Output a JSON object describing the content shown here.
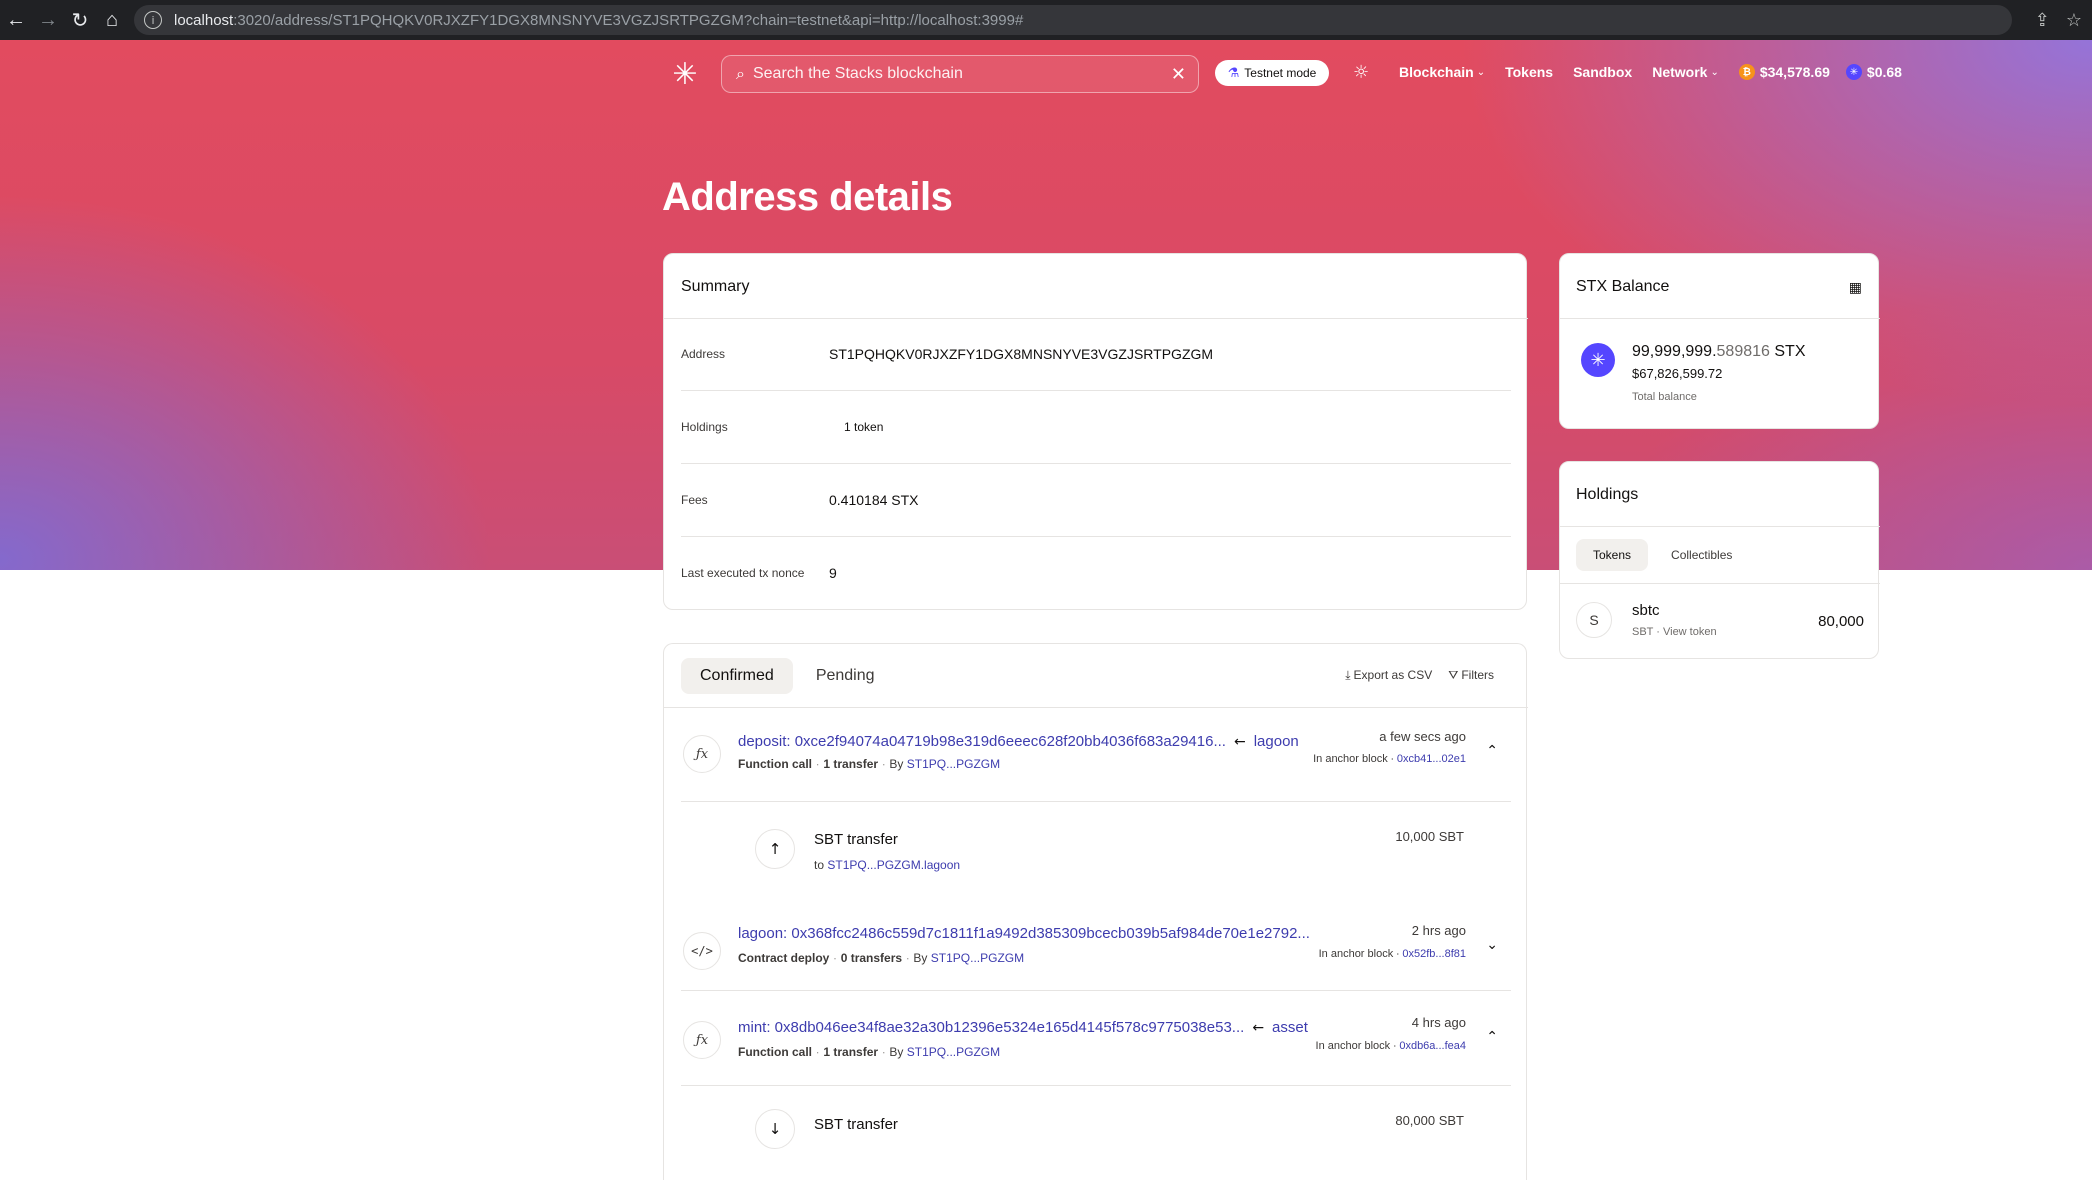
{
  "browser": {
    "url_host": "localhost",
    "url_path": ":3020/address/ST1PQHQKV0RJXZFY1DGX8MNSNYVE3VGZJSRTPGZGM?chain=testnet&api=http://localhost:3999#"
  },
  "nav": {
    "search_placeholder": "Search the Stacks blockchain",
    "testnet_label": "Testnet mode",
    "links": [
      "Blockchain",
      "Tokens",
      "Sandbox",
      "Network"
    ],
    "btc_price": "$34,578.69",
    "stx_price": "$0.68"
  },
  "page": {
    "title": "Address details"
  },
  "summary": {
    "header": "Summary",
    "rows": [
      {
        "label": "Address",
        "value": "ST1PQHQKV0RJXZFY1DGX8MNSNYVE3VGZJSRTPGZGM"
      },
      {
        "label": "Holdings",
        "value": "1 token"
      },
      {
        "label": "Fees",
        "value": "0.410184 STX"
      },
      {
        "label": "Last executed tx nonce",
        "value": "9"
      }
    ]
  },
  "balance": {
    "header": "STX Balance",
    "amount_int": "99,999,999.",
    "amount_dec": "589816",
    "unit": "STX",
    "usd": "$67,826,599.72",
    "total_label": "Total balance"
  },
  "holdings": {
    "header": "Holdings",
    "tabs": [
      "Tokens",
      "Collectibles"
    ],
    "token": {
      "icon_letter": "S",
      "name": "sbtc",
      "symbol": "SBT",
      "link": "View token",
      "balance": "80,000"
    }
  },
  "transactions": {
    "tabs": [
      "Confirmed",
      "Pending"
    ],
    "export_label": "Export as CSV",
    "filters_label": "Filters",
    "items": [
      {
        "title": "deposit: 0xce2f94074a04719b98e319d6eeec628f20bb4036f683a29416...",
        "contract": "lagoon",
        "type": "Function call",
        "transfers": "1 transfer",
        "by_prefix": "By",
        "by": "ST1PQ...PGZGM",
        "time": "a few secs ago",
        "block_prefix": "In anchor block",
        "block": "0xcb41...02e1",
        "transfer": {
          "title": "SBT transfer",
          "to_prefix": "to",
          "to": "ST1PQ...PGZGM.lagoon",
          "amount": "10,000 SBT"
        }
      },
      {
        "title": "lagoon: 0x368fcc2486c559d7c1811f1a9492d385309bcecb039b5af984de70e1e2792...",
        "type": "Contract deploy",
        "transfers": "0 transfers",
        "by_prefix": "By",
        "by": "ST1PQ...PGZGM",
        "time": "2 hrs ago",
        "block_prefix": "In anchor block",
        "block": "0x52fb...8f81"
      },
      {
        "title": "mint: 0x8db046ee34f8ae32a30b12396e5324e165d4145f578c9775038e53...",
        "contract": "asset",
        "type": "Function call",
        "transfers": "1 transfer",
        "by_prefix": "By",
        "by": "ST1PQ...PGZGM",
        "time": "4 hrs ago",
        "block_prefix": "In anchor block",
        "block": "0xdb6a...fea4",
        "transfer": {
          "title": "SBT transfer",
          "amount": "80,000 SBT"
        }
      }
    ]
  },
  "colors": {
    "accent": "#5546ff",
    "link": "#3d3cae",
    "hero_red": "#e24b5f",
    "btc": "#f7931a"
  },
  "icons": {
    "logo": "stacks-logo-icon",
    "function": "function-icon",
    "code": "code-icon",
    "arrow_up": "arrow-up-icon",
    "arrow_down": "arrow-down-icon"
  }
}
